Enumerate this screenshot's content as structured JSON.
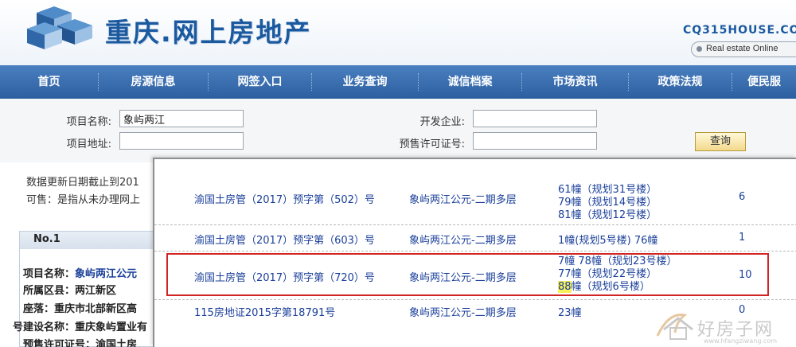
{
  "header": {
    "title": "重庆.网上房地产",
    "domain": "CQ315HOUSE.CO",
    "subtitle": "Real estate Online"
  },
  "nav": [
    "首页",
    "房源信息",
    "网签入口",
    "业务查询",
    "诚信档案",
    "市场资讯",
    "政策法规",
    "便民服"
  ],
  "search": {
    "project_name_label": "项目名称:",
    "project_name_value": "象屿两江",
    "project_address_label": "项目地址:",
    "project_address_value": "",
    "developer_label": "开发企业:",
    "developer_value": "",
    "permit_label": "预售许可证号:",
    "permit_value": "",
    "query_label": "查询"
  },
  "notes": [
    "数据更新日期截止到201",
    "可售：是指从未办理网上"
  ],
  "item": {
    "no": "No.1",
    "fields": [
      {
        "k": "项目名称：",
        "v": "象屿两江公元"
      },
      {
        "k": "所属区县：",
        "v": "两江新区"
      },
      {
        "k": "座落：",
        "v": "重庆市北部新区高"
      },
      {
        "k": "号建设名称：",
        "v": "重庆象屿置业有"
      },
      {
        "k": "预售许可证号：",
        "v": "渝国土房"
      }
    ]
  },
  "popup": {
    "rows": [
      {
        "permit": "渝国土房管（2017）预字第（502）号",
        "project": "象屿两江公元-二期多层",
        "buildings": [
          "61幢（规划31号楼）",
          "79幢（规划14号楼）",
          "81幢（规划12号楼）"
        ],
        "count": "6"
      },
      {
        "permit": "渝国土房管（2017）预字第（603）号",
        "project": "象屿两江公元-二期多层",
        "buildings": [
          "1幢(规划5号楼)  76幢"
        ],
        "count": "1"
      },
      {
        "permit": "渝国土房管（2017）预字第（720）号",
        "project": "象屿两江公元-二期多层",
        "buildings": [
          "7幢  78幢（规划23号楼）",
          "77幢（规划22号楼）"
        ],
        "highlight_prefix": "88",
        "highlight_rest": "幢（规划6号楼）",
        "count": "10"
      },
      {
        "permit": "115房地证2015字第18791号",
        "project": "象屿两江公元-二期多层",
        "buildings": [
          "23幢"
        ],
        "count": "0"
      }
    ]
  },
  "watermark": {
    "text": "好房子网",
    "url": "www.hfangziwang.com"
  },
  "colors": {
    "brand": "#1c5aa0",
    "nav": "#2c5f9f",
    "link": "#1a3f9a",
    "highlight_box": "#d12424",
    "highlight_text": "#f8f05a"
  }
}
